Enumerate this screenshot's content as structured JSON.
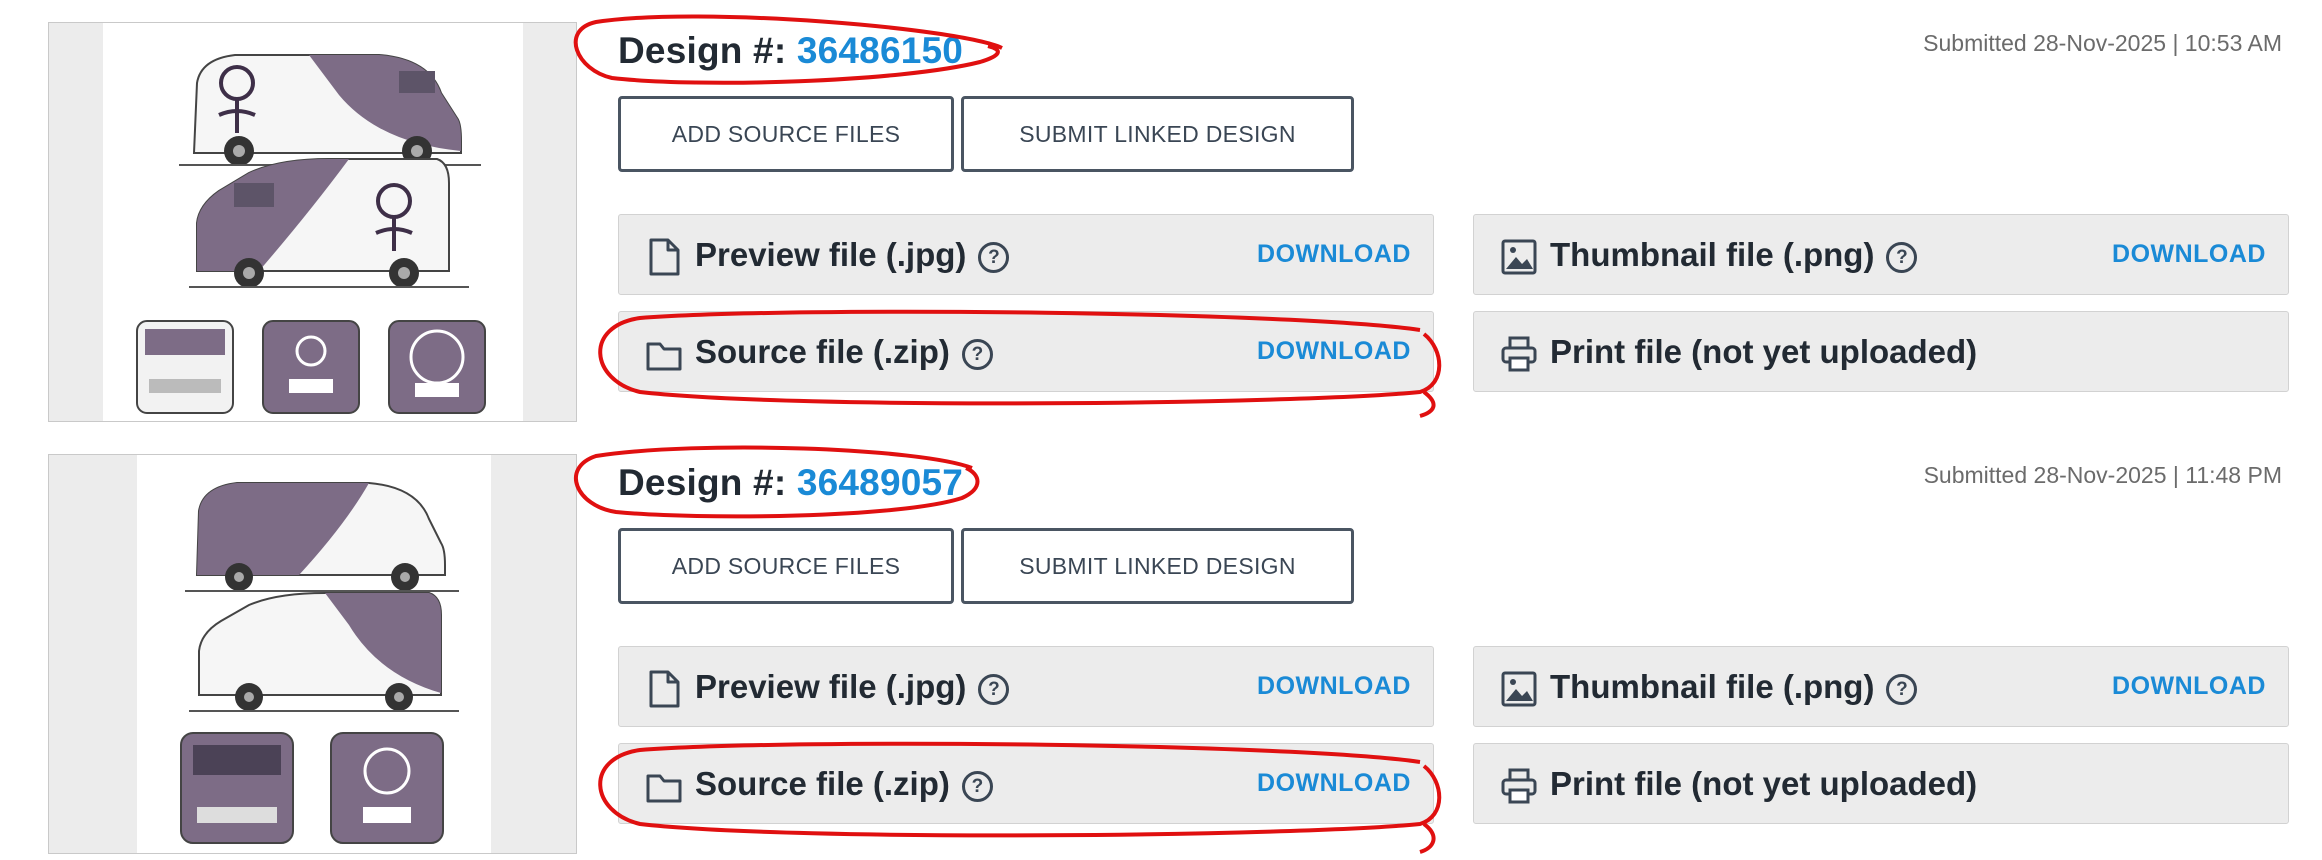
{
  "designs": [
    {
      "label": "Design #:",
      "number": "36486150",
      "submitted": "Submitted 28-Nov-2025 | 10:53 AM",
      "buttons": {
        "add_source": "ADD SOURCE FILES",
        "submit_linked": "SUBMIT LINKED DESIGN"
      },
      "files": {
        "preview": {
          "label": "Preview file (.jpg)",
          "action": "DOWNLOAD",
          "icon": "file-icon"
        },
        "source": {
          "label": "Source file (.zip)",
          "action": "DOWNLOAD",
          "icon": "folder-icon"
        },
        "thumbnail": {
          "label": "Thumbnail file (.png)",
          "action": "DOWNLOAD",
          "icon": "image-icon"
        },
        "print": {
          "label": "Print file (not yet uploaded)",
          "icon": "printer-icon"
        }
      },
      "help_glyph": "?"
    },
    {
      "label": "Design #:",
      "number": "36489057",
      "submitted": "Submitted 28-Nov-2025 | 11:48 PM",
      "buttons": {
        "add_source": "ADD SOURCE FILES",
        "submit_linked": "SUBMIT LINKED DESIGN"
      },
      "files": {
        "preview": {
          "label": "Preview file (.jpg)",
          "action": "DOWNLOAD",
          "icon": "file-icon"
        },
        "source": {
          "label": "Source file (.zip)",
          "action": "DOWNLOAD",
          "icon": "folder-icon"
        },
        "thumbnail": {
          "label": "Thumbnail file (.png)",
          "action": "DOWNLOAD",
          "icon": "image-icon"
        },
        "print": {
          "label": "Print file (not yet uploaded)",
          "icon": "printer-icon"
        }
      },
      "help_glyph": "?"
    }
  ],
  "colors": {
    "link": "#1a8ad6",
    "text": "#222a33",
    "card_bg": "#ececec",
    "button_border": "#4a5562",
    "annotation": "#e01010",
    "van_purple": "#7d6c86"
  }
}
